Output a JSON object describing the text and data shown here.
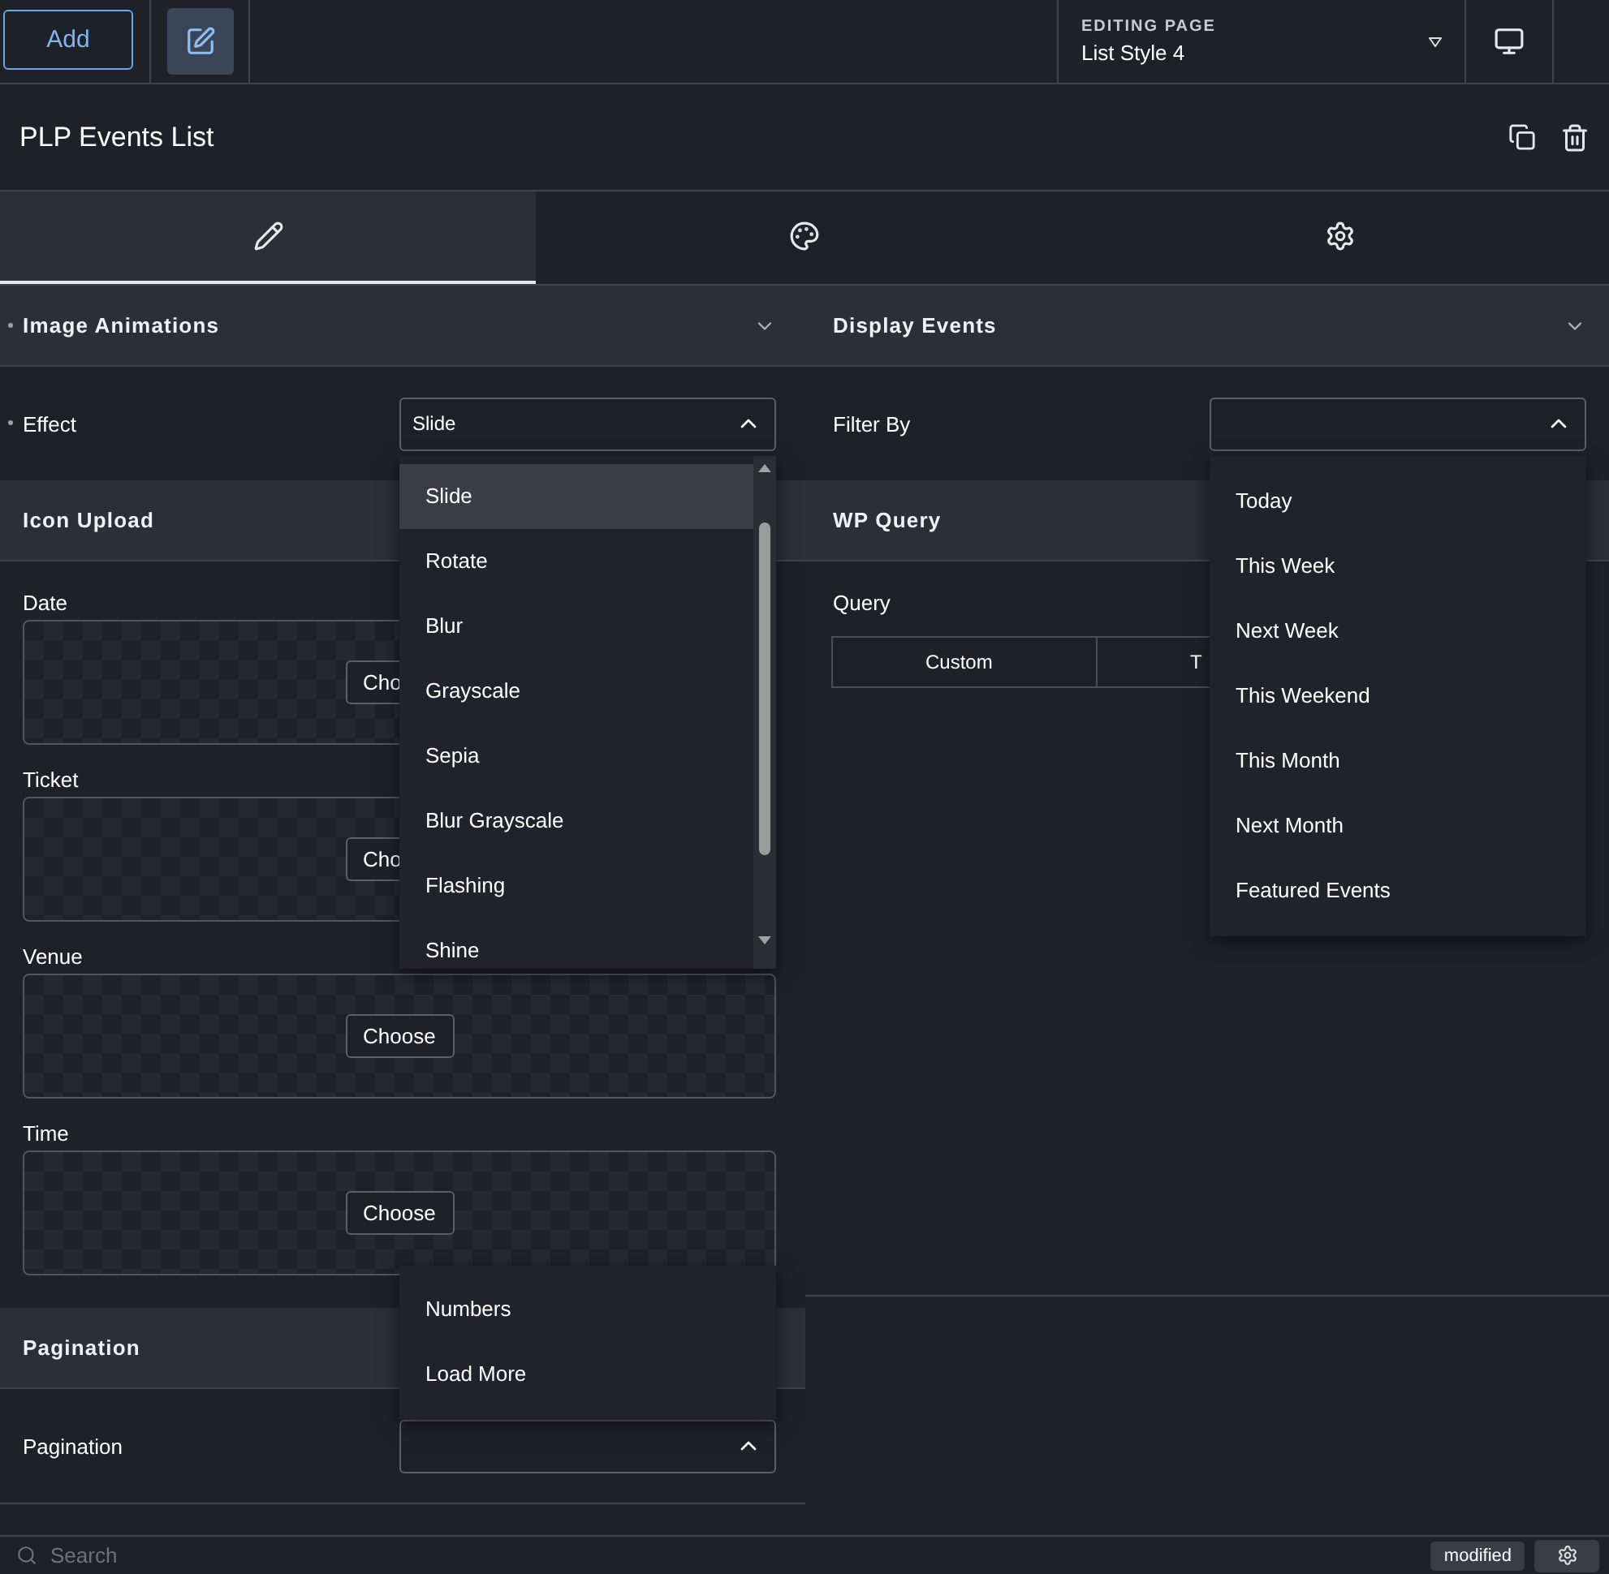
{
  "toolbar": {
    "add_button": "Add",
    "edit_active": true,
    "editing_page": {
      "label": "EDITING PAGE",
      "value": "List Style 4"
    }
  },
  "widget_title": "PLP Events List",
  "tabs": [
    {
      "kind": "content",
      "selected": true
    },
    {
      "kind": "style",
      "selected": false
    },
    {
      "kind": "advanced",
      "selected": false
    }
  ],
  "columns": [
    [
      {
        "title": "Image Animations",
        "marked": true,
        "toggle": true,
        "controls": [
          {
            "kind": "select",
            "label": "Effect",
            "marked": true,
            "value": "Slide",
            "open": true,
            "opens_up": false,
            "scroll": true,
            "options": [
              {
                "label": "Slide",
                "selected": true
              },
              {
                "label": "Rotate",
                "selected": false
              },
              {
                "label": "Blur",
                "selected": false
              },
              {
                "label": "Grayscale",
                "selected": false
              },
              {
                "label": "Sepia",
                "selected": false
              },
              {
                "label": "Blur Grayscale",
                "selected": false
              },
              {
                "label": "Flashing",
                "selected": false
              },
              {
                "label": "Shine",
                "selected": false
              }
            ]
          }
        ]
      },
      {
        "title": "Icon Upload",
        "marked": false,
        "controls": [
          {
            "kind": "image",
            "label": "Date",
            "button": "Cho"
          },
          {
            "kind": "image",
            "label": "Ticket",
            "button": "Cho"
          },
          {
            "kind": "image",
            "label": "Venue",
            "button": "Choose"
          },
          {
            "kind": "image",
            "label": "Time",
            "button": "Choose"
          }
        ]
      },
      {
        "title": "Pagination",
        "marked": false,
        "controls": [
          {
            "kind": "select",
            "label": "Pagination",
            "marked": false,
            "open": true,
            "opens_up": true,
            "scroll": false,
            "options": [
              {
                "label": "Numbers",
                "selected": false
              },
              {
                "label": "Load More",
                "selected": false
              }
            ]
          }
        ]
      }
    ],
    [
      {
        "title": "Display Events",
        "marked": false,
        "toggle": true,
        "controls": [
          {
            "kind": "select",
            "label": "Filter By",
            "marked": false,
            "open": true,
            "opens_up": false,
            "scroll": false,
            "options": [
              {
                "label": "Today",
                "selected": false
              },
              {
                "label": "This Week",
                "selected": false
              },
              {
                "label": "Next Week",
                "selected": false
              },
              {
                "label": "This Weekend",
                "selected": false
              },
              {
                "label": "This Month",
                "selected": false
              },
              {
                "label": "Next Month",
                "selected": false
              },
              {
                "label": "Featured Events",
                "selected": false
              }
            ]
          }
        ]
      },
      {
        "title": "WP Query",
        "marked": false,
        "controls": [
          {
            "kind": "segmented",
            "label": "Query",
            "options": [
              {
                "label": "Custom",
                "selected": false
              },
              {
                "label": "T",
                "selected": false
              }
            ]
          }
        ]
      }
    ]
  ],
  "footer": {
    "search_placeholder": "Search",
    "badge": "modified"
  }
}
